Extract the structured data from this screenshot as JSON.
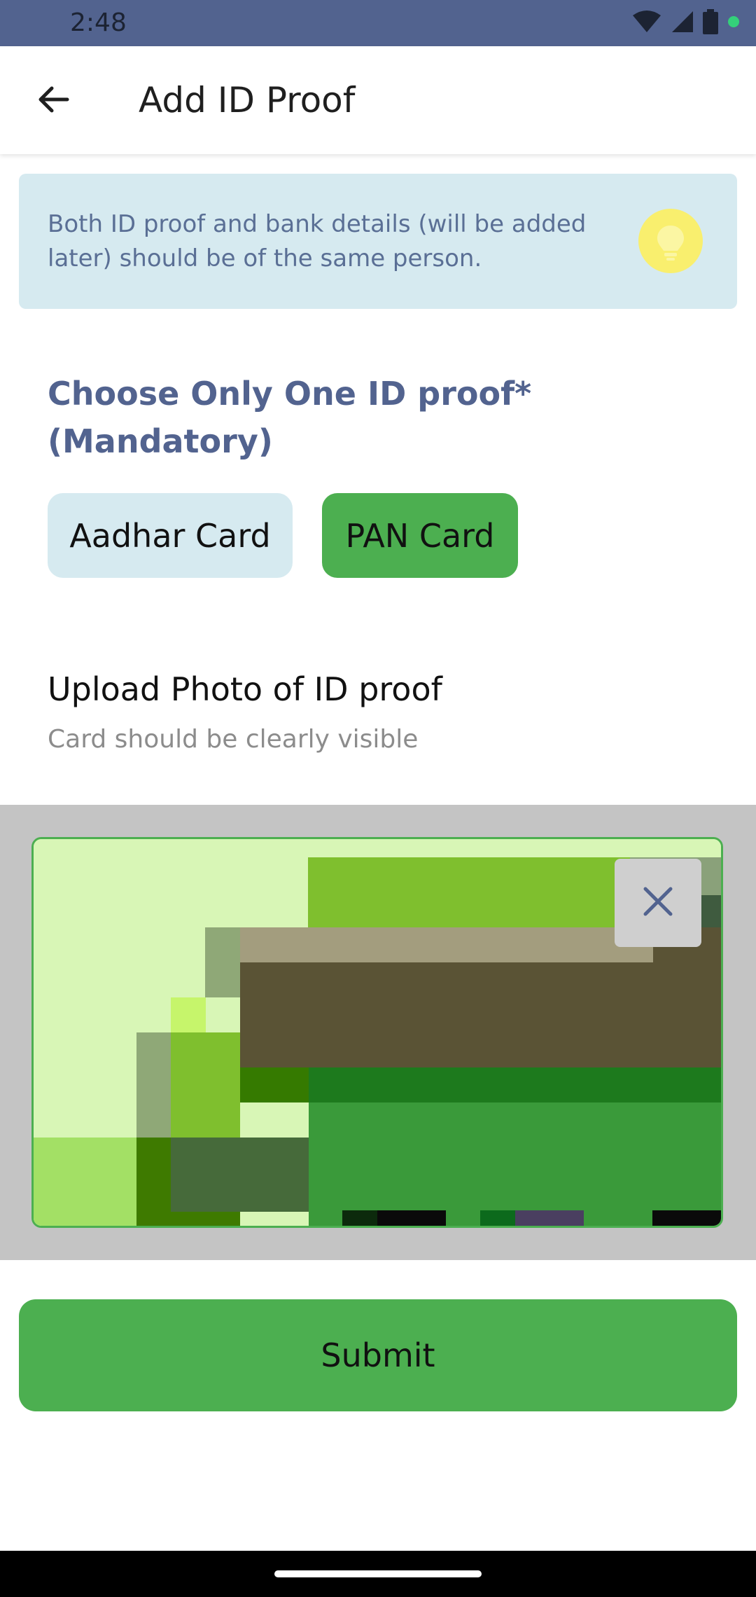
{
  "status_bar": {
    "time": "2:48",
    "icons": [
      "wifi-icon",
      "signal-icon",
      "battery-icon",
      "notification-dot-icon"
    ],
    "background": "#52638f"
  },
  "app_bar": {
    "back_icon": "arrow-back-icon",
    "title": "Add ID Proof"
  },
  "info_card": {
    "text": "Both ID proof and bank details (will be added later) should be of the same person.",
    "icon": "lightbulb-icon",
    "background": "#d6eaf0"
  },
  "id_section": {
    "heading": "Choose Only One ID proof* (Mandatory)",
    "options": [
      {
        "label": "Aadhar Card",
        "selected": false
      },
      {
        "label": "PAN Card",
        "selected": true
      }
    ]
  },
  "upload": {
    "title": "Upload Photo of ID proof",
    "subtitle": "Card should be clearly visible",
    "remove_icon": "close-icon"
  },
  "submit": {
    "label": "Submit"
  },
  "colors": {
    "accent": "#4caf50",
    "heading": "#52638f",
    "chip_unselected": "#d6eaf0",
    "bulb": "#f9ef6e"
  }
}
